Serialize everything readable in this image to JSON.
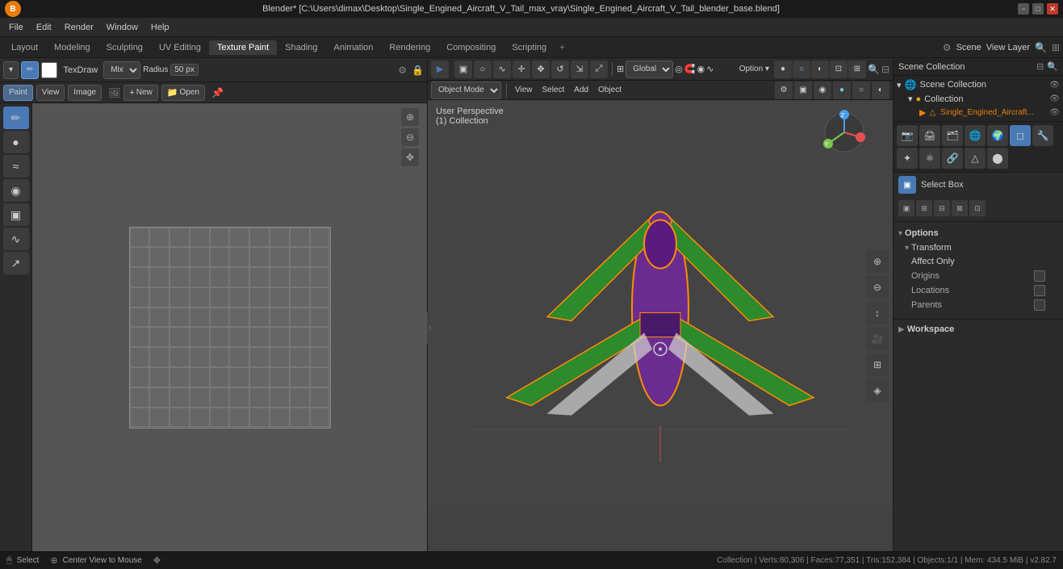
{
  "titlebar": {
    "title": "Blender* [C:\\Users\\dimax\\Desktop\\Single_Engined_Aircraft_V_Tail_max_vray\\Single_Engined_Aircraft_V_Tail_blender_base.blend]",
    "min_label": "−",
    "max_label": "□",
    "close_label": "✕"
  },
  "menubar": {
    "logo": "B",
    "items": [
      "File",
      "Edit",
      "Render",
      "Window",
      "Help"
    ]
  },
  "workspacebar": {
    "tabs": [
      "Layout",
      "Modeling",
      "Sculpting",
      "UV Editing",
      "Texture Paint",
      "Shading",
      "Animation",
      "Rendering",
      "Compositing",
      "Scripting"
    ],
    "active_tab": "Texture Paint",
    "plus_label": "+",
    "scene_label": "Scene",
    "view_layer_label": "View Layer"
  },
  "left_toolbar": {
    "mode_icon": "▾",
    "brush_icon": "✏",
    "color_preview": "#ffffff",
    "tool_name": "TexDraw",
    "blend_mode": "Mix",
    "radius_label": "Radius",
    "radius_value": "50 px",
    "paint_btn": "Paint",
    "view_btn": "View",
    "image_btn": "Image",
    "new_btn": "New",
    "open_btn": "Open"
  },
  "tool_icons": [
    {
      "icon": "✏",
      "label": "draw",
      "active": true
    },
    {
      "icon": "●",
      "label": "soften"
    },
    {
      "icon": "≈",
      "label": "smear"
    },
    {
      "icon": "◉",
      "label": "clone"
    },
    {
      "icon": "▣",
      "label": "fill"
    },
    {
      "icon": "∿",
      "label": "mask"
    },
    {
      "icon": "↗",
      "label": "annotate"
    }
  ],
  "viewport": {
    "perspective_label": "User Perspective",
    "collection_label": "(1) Collection",
    "mode_select": "Object Mode",
    "view_btn": "View",
    "select_btn": "Select",
    "add_btn": "Add",
    "object_btn": "Object"
  },
  "nav_gizmos": [
    {
      "icon": "⊕",
      "label": "zoom-in"
    },
    {
      "icon": "⊖",
      "label": "zoom-out"
    },
    {
      "icon": "↕",
      "label": "pan-vertical"
    },
    {
      "icon": "↔",
      "label": "pan-horizontal"
    },
    {
      "icon": "⟳",
      "label": "camera-view"
    },
    {
      "icon": "⊞",
      "label": "grid-view"
    },
    {
      "icon": "◈",
      "label": "local-view"
    }
  ],
  "right_panel": {
    "scene_collection_label": "Scene Collection",
    "collections": [
      {
        "label": "Scene Collection",
        "type": "scene",
        "level": 0
      },
      {
        "label": "Collection",
        "type": "collection",
        "level": 1
      },
      {
        "label": "Single_Engined_Aircraft...",
        "type": "object",
        "level": 2
      }
    ],
    "properties": {
      "select_box_label": "Select Box",
      "options_label": "Options",
      "transform_label": "Transform",
      "affect_only_label": "Affect Only",
      "origins_label": "Origins",
      "locations_label": "Locations",
      "parents_label": "Parents",
      "workspace_label": "Workspace"
    }
  },
  "statusbar": {
    "select_label": "Select",
    "center_view_label": "Center View to Mouse",
    "stats": "Collection | Verts:80,306 | Faces:77,351 | Tris:152,384 | Objects:1/1 | Mem: 434.5 MiB | v2.82.7"
  }
}
